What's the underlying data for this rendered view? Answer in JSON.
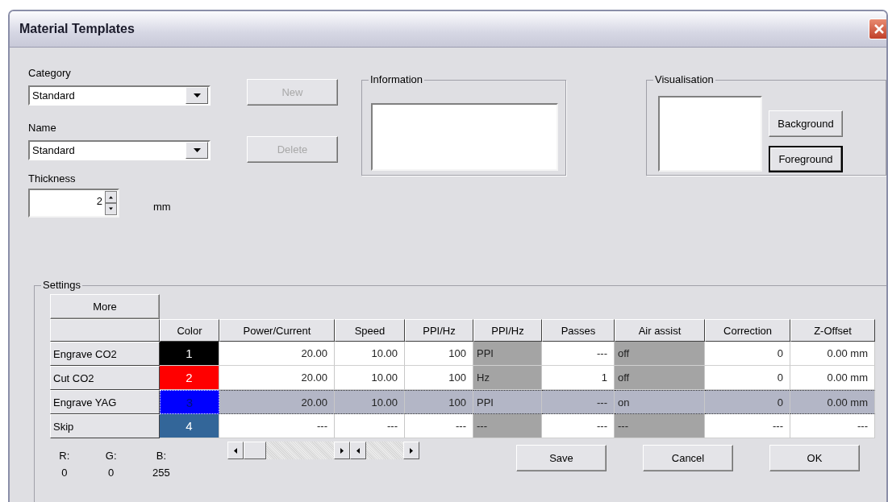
{
  "window": {
    "title": "Material Templates"
  },
  "category": {
    "label": "Category",
    "value": "Standard"
  },
  "name": {
    "label": "Name",
    "value": "Standard"
  },
  "thickness": {
    "label": "Thickness",
    "value": "2",
    "unit": "mm"
  },
  "side_buttons": [
    {
      "label": "New",
      "disabled": true
    },
    {
      "label": "Delete",
      "disabled": true
    }
  ],
  "information": {
    "title": "Information"
  },
  "visualisation": {
    "title": "Visualisation",
    "buttons": [
      {
        "label": "Background",
        "focused": false
      },
      {
        "label": "Foreground",
        "focused": true
      }
    ]
  },
  "settings": {
    "title": "Settings",
    "more_button": "More",
    "columns": [
      {
        "label": "Color",
        "kind": "color"
      },
      {
        "label": "Power/Current",
        "kind": "number"
      },
      {
        "label": "Speed",
        "kind": "number"
      },
      {
        "label": "PPI/Hz",
        "kind": "number"
      },
      {
        "label": "PPI/Hz",
        "kind": "option"
      },
      {
        "label": "Passes",
        "kind": "number"
      },
      {
        "label": "Air assist",
        "kind": "option"
      },
      {
        "label": "Correction",
        "kind": "number"
      },
      {
        "label": "Z-Offset",
        "kind": "number"
      }
    ],
    "rows": [
      {
        "name": "Engrave CO2",
        "selected": false,
        "color": "#000000",
        "cells": [
          "1",
          "20.00",
          "10.00",
          "100",
          "PPI",
          "---",
          "off",
          "0",
          "0.00 mm"
        ]
      },
      {
        "name": "Cut CO2",
        "selected": false,
        "color": "#ff0000",
        "cells": [
          "2",
          "20.00",
          "10.00",
          "100",
          "Hz",
          "1",
          "off",
          "0",
          "0.00 mm"
        ]
      },
      {
        "name": "Engrave YAG",
        "selected": true,
        "color": "#0000ff",
        "cells": [
          "3",
          "20.00",
          "10.00",
          "100",
          "PPI",
          "---",
          "on",
          "0",
          "0.00 mm"
        ]
      },
      {
        "name": "Skip",
        "selected": false,
        "color": "#336699",
        "cells": [
          "4",
          "---",
          "---",
          "---",
          "---",
          "---",
          "---",
          "---",
          "---"
        ]
      }
    ],
    "rgb": [
      {
        "label": "R:",
        "value": "0"
      },
      {
        "label": "G:",
        "value": "0"
      },
      {
        "label": "B:",
        "value": "255"
      }
    ]
  },
  "buttons": [
    {
      "label": "Save"
    },
    {
      "label": "Cancel"
    },
    {
      "label": "OK"
    }
  ]
}
